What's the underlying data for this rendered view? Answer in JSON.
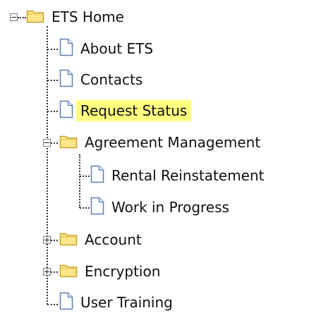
{
  "tree": {
    "root": {
      "label": "ETS Home",
      "icon": "folder-icon",
      "expander": "collapse"
    },
    "items": [
      {
        "label": "About ETS",
        "icon": "page-icon"
      },
      {
        "label": "Contacts",
        "icon": "page-icon"
      },
      {
        "label": "Request Status",
        "icon": "page-icon",
        "selected": true
      },
      {
        "label": "Agreement Management",
        "icon": "folder-icon",
        "expander": "collapse"
      },
      {
        "label": "Rental Reinstatement",
        "icon": "page-icon"
      },
      {
        "label": "Work in Progress",
        "icon": "page-icon"
      },
      {
        "label": "Account",
        "icon": "folder-icon",
        "expander": "expand"
      },
      {
        "label": "Encryption",
        "icon": "folder-icon",
        "expander": "expand"
      },
      {
        "label": "User Training",
        "icon": "page-icon"
      }
    ]
  },
  "colors": {
    "selection_highlight": "#ffff80",
    "folder_fill": "#ffe68a",
    "folder_border": "#c9a227",
    "page_fill": "#ffffff",
    "page_border": "#5b7fb5"
  }
}
